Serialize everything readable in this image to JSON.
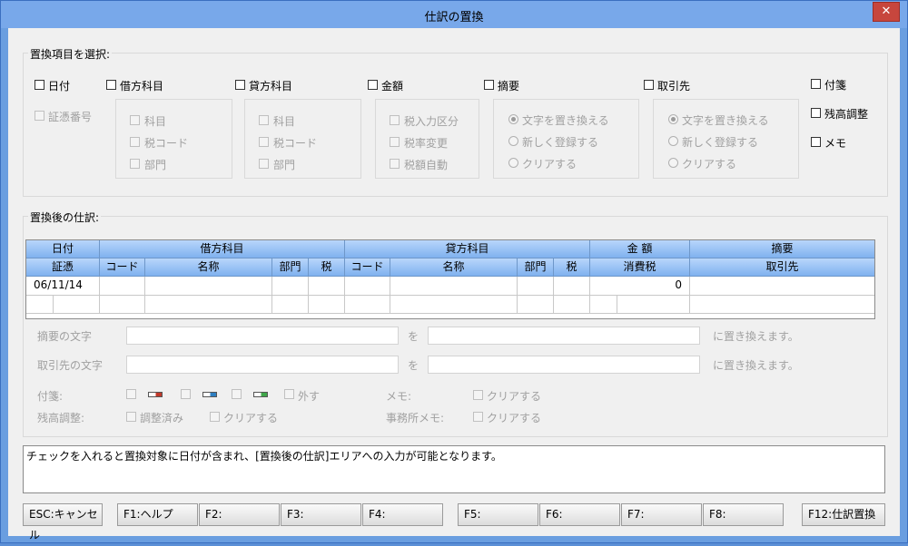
{
  "window": {
    "title": "仕訳の置換",
    "close_glyph": "✕"
  },
  "select_group": {
    "title": "置換項目を選択:",
    "date": "日付",
    "voucher_no": "証憑番号",
    "debit": {
      "label": "借方科目",
      "opts": [
        "科目",
        "税コード",
        "部門"
      ]
    },
    "credit": {
      "label": "貸方科目",
      "opts": [
        "科目",
        "税コード",
        "部門"
      ]
    },
    "amount": {
      "label": "金額",
      "opts": [
        "税入力区分",
        "税率変更",
        "税額自動"
      ]
    },
    "summary": {
      "label": "摘要",
      "opts": [
        "文字を置き換える",
        "新しく登録する",
        "クリアする"
      ]
    },
    "partner": {
      "label": "取引先",
      "opts": [
        "文字を置き換える",
        "新しく登録する",
        "クリアする"
      ]
    },
    "sticky": "付箋",
    "balance": "残高調整",
    "memo": "メモ"
  },
  "after_group": {
    "title": "置換後の仕訳:",
    "header_top": [
      "日付",
      "借方科目",
      "貸方科目",
      "金 額",
      "摘要"
    ],
    "header_bottom": [
      "証憑",
      "コード",
      "名称",
      "部門",
      "税",
      "コード",
      "名称",
      "部門",
      "税",
      "消費税",
      "取引先"
    ],
    "row": {
      "date": "06/11/14",
      "tax_value": "0"
    }
  },
  "replace_form": {
    "summary_label": "摘要の文字",
    "partner_label": "取引先の文字",
    "wo": "を",
    "suffix": "に置き換えます。",
    "sticky_label": "付箋:",
    "remove": "外す",
    "balance_label": "残高調整:",
    "adjusted": "調整済み",
    "clear": "クリアする",
    "memo_label": "メモ:",
    "office_memo_label": "事務所メモ:",
    "tag_colors": [
      "#c0392b",
      "#2f7fc1",
      "#3fa64a"
    ]
  },
  "message": "チェックを入れると置換対象に日付が含まれ、[置換後の仕訳]エリアへの入力が可能となります。",
  "fkeys": [
    "ESC:キャンセル",
    "F1:ヘルプ",
    "F2:",
    "F3:",
    "F4:",
    "F5:",
    "F6:",
    "F7:",
    "F8:",
    "F12:仕訳置換"
  ]
}
